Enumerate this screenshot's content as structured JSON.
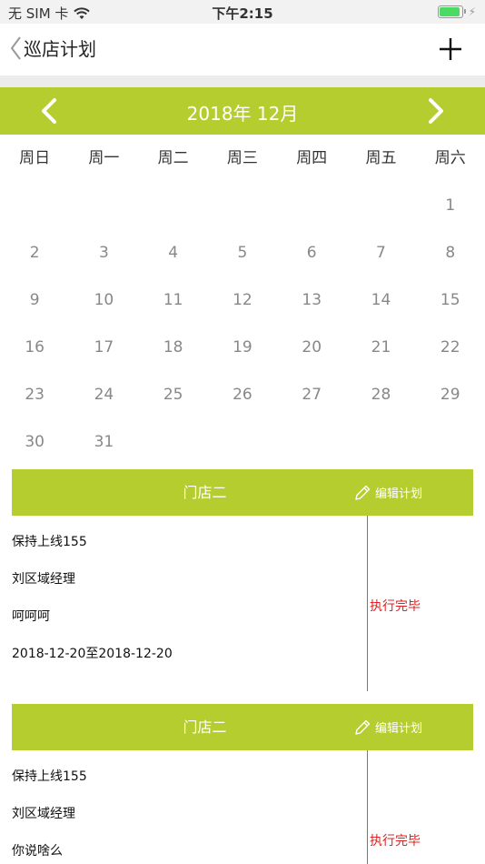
{
  "status_bar": {
    "carrier": "无 SIM 卡",
    "time": "下午2:15",
    "battery_level": 1.0,
    "battery_color": "#4cd964"
  },
  "nav": {
    "back_title": "巡店计划",
    "back_icon": "chevron-left-icon",
    "add_icon": "plus-icon"
  },
  "calendar": {
    "title": "2018年 12月",
    "accent_color": "#b6cd2f",
    "weekdays": [
      "周日",
      "周一",
      "周二",
      "周三",
      "周四",
      "周五",
      "周六"
    ],
    "weeks": [
      [
        "",
        "",
        "",
        "",
        "",
        "",
        "1"
      ],
      [
        "2",
        "3",
        "4",
        "5",
        "6",
        "7",
        "8"
      ],
      [
        "9",
        "10",
        "11",
        "12",
        "13",
        "14",
        "15"
      ],
      [
        "16",
        "17",
        "18",
        "19",
        "20",
        "21",
        "22"
      ],
      [
        "23",
        "24",
        "25",
        "26",
        "27",
        "28",
        "29"
      ],
      [
        "30",
        "31",
        "",
        "",
        "",
        "",
        ""
      ]
    ]
  },
  "plans": [
    {
      "store": "门店二",
      "edit_label": "编辑计划",
      "lines": [
        "保持上线155",
        "刘区域经理",
        "呵呵呵",
        "2018-12-20至2018-12-20"
      ],
      "status": "执行完毕"
    },
    {
      "store": "门店二",
      "edit_label": "编辑计划",
      "lines": [
        "保持上线155",
        "刘区域经理",
        "你说啥么"
      ],
      "status": "执行完毕"
    }
  ]
}
